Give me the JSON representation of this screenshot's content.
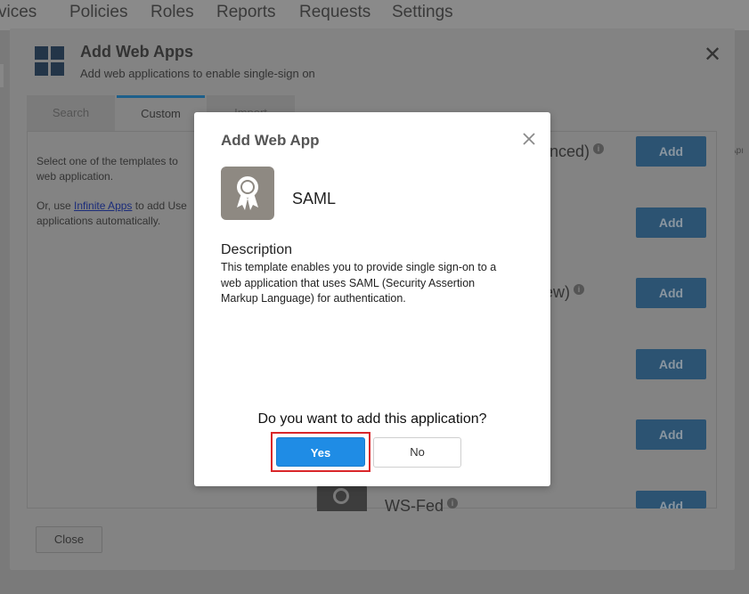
{
  "top_nav": {
    "items": [
      "vices",
      "Policies",
      "Roles",
      "Reports",
      "Requests",
      "Settings"
    ]
  },
  "panel": {
    "title": "Add Web Apps",
    "subtitle": "Add web applications to enable single-sign on",
    "tabs": [
      "Search",
      "Custom",
      "Import"
    ],
    "intro_line1": "Select one of the templates to",
    "intro_line2": "web application.",
    "use_prefix": "Or, use ",
    "infinite_apps_link": "Infinite Apps",
    "use_suffix": " to add Use",
    "use_line2": "applications automatically.",
    "rows": [
      {
        "text": "anced)",
        "info": "i"
      },
      {
        "text": "ew)",
        "info": "i"
      },
      {
        "text": "WS-Fed",
        "info": "i"
      }
    ],
    "add_label": "Add",
    "close_label": "Close",
    "right_edge_text": "Apı"
  },
  "modal": {
    "title": "Add Web App",
    "app_name": "SAML",
    "description_title": "Description",
    "description_text": "This template enables you to provide single sign-on to a web application that uses SAML (Security Assertion Markup Language) for authentication.",
    "question": "Do you want to add this application?",
    "yes_label": "Yes",
    "no_label": "No",
    "icons": {
      "close": "close-icon",
      "app": "ribbon-award-icon"
    },
    "colors": {
      "primary": "#1f8ce5",
      "highlight": "#d9262a",
      "icon_bg": "#8e8982"
    }
  }
}
